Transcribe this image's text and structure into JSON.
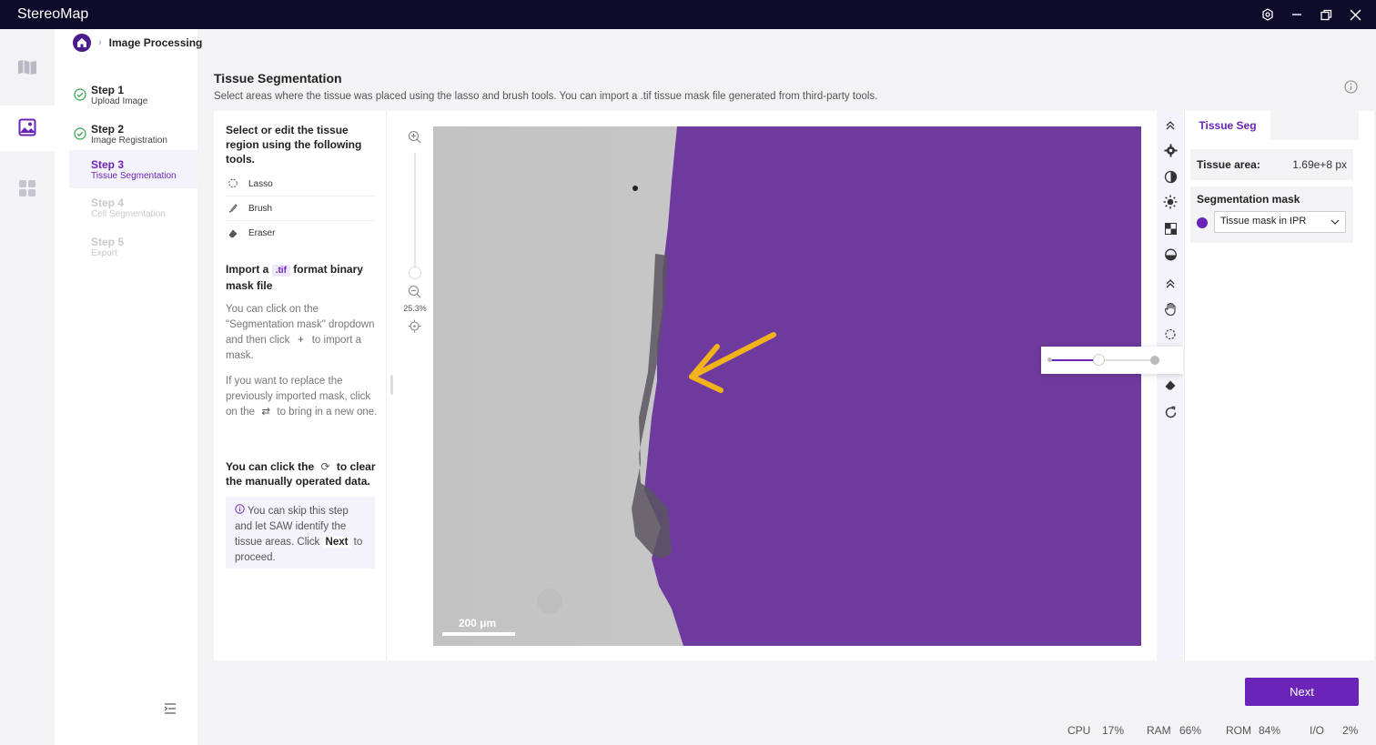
{
  "app": {
    "title": "StereoMap"
  },
  "breadcrumb": {
    "current": "Image Processing"
  },
  "steps": [
    {
      "title": "Step 1",
      "subtitle": "Upload Image",
      "state": "done"
    },
    {
      "title": "Step 2",
      "subtitle": "Image Registration",
      "state": "done"
    },
    {
      "title": "Step 3",
      "subtitle": "Tissue Segmentation",
      "state": "active"
    },
    {
      "title": "Step 4",
      "subtitle": "Cell Segmentation",
      "state": "disabled"
    },
    {
      "title": "Step 5",
      "subtitle": "Export",
      "state": "disabled"
    }
  ],
  "main": {
    "title": "Tissue Segmentation",
    "description": "Select areas where the tissue was placed using the lasso and brush tools. You can import a .tif tissue mask file generated from third-party tools."
  },
  "instructions": {
    "heading": "Select or edit the tissue region using the following tools.",
    "tools": [
      "Lasso",
      "Brush",
      "Eraser"
    ],
    "import_prefix": "Import a",
    "import_tag": ".tif",
    "import_suffix": "format binary mask file",
    "para1_a": "You can click on the \"Segmentation mask\" dropdown and then click",
    "para1_b": "to import a mask.",
    "para2_a": "If you want to replace the previously imported mask, click on the",
    "para2_b": "to bring in a new one.",
    "clear_a": "You can click the",
    "clear_b": "to clear the manually operated data.",
    "tip_a": "You can skip this step and let SAW identify the tissue areas. Click",
    "tip_next": "Next",
    "tip_b": "to proceed."
  },
  "viewer": {
    "zoom": "25.3%",
    "scale_label": "200 μm"
  },
  "brush_size": 0.45,
  "side": {
    "tab": "Tissue Seg",
    "area_label": "Tissue area:",
    "area_value": "1.69e+8 px",
    "mask_heading": "Segmentation mask",
    "mask_selected": "Tissue mask in IPR"
  },
  "next_label": "Next",
  "status": {
    "cpu_label": "CPU",
    "cpu": "17%",
    "ram_label": "RAM",
    "ram": "66%",
    "rom_label": "ROM",
    "rom": "84%",
    "io_label": "I/O",
    "io": "2%"
  },
  "colors": {
    "accent": "#6a24b8",
    "annotation_arrow": "#f2b21b",
    "tissue": "#6f3a9e"
  }
}
